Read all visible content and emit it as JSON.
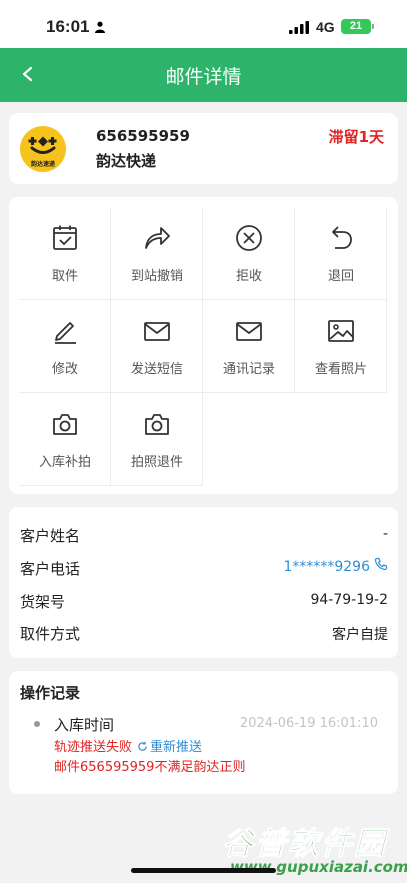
{
  "status_bar": {
    "time": "16:01",
    "network": "4G",
    "battery": "21"
  },
  "nav": {
    "title": "邮件详情"
  },
  "parcel": {
    "logo_text": "韵达速递",
    "tracking_number": "656595959",
    "courier": "韵达快递",
    "stay_status": "滞留1天"
  },
  "actions": [
    {
      "label": "取件",
      "icon": "calendar-check-icon"
    },
    {
      "label": "到站撤销",
      "icon": "share-arrow-icon"
    },
    {
      "label": "拒收",
      "icon": "circle-x-icon"
    },
    {
      "label": "退回",
      "icon": "undo-arrow-icon"
    },
    {
      "label": "修改",
      "icon": "pencil-icon"
    },
    {
      "label": "发送短信",
      "icon": "envelope-icon"
    },
    {
      "label": "通讯记录",
      "icon": "envelope-icon"
    },
    {
      "label": "查看照片",
      "icon": "photo-icon"
    },
    {
      "label": "入库补拍",
      "icon": "camera-icon"
    },
    {
      "label": "拍照退件",
      "icon": "camera-icon"
    }
  ],
  "customer": {
    "name_label": "客户姓名",
    "name_value": "-",
    "phone_label": "客户电话",
    "phone_value": "1******9296",
    "shelf_label": "货架号",
    "shelf_value": "94-79-19-2",
    "method_label": "取件方式",
    "method_value": "客户自提"
  },
  "log": {
    "title": "操作记录",
    "event": "入库时间",
    "time": "2024-06-19 16:01:10",
    "error": "轨迹推送失败",
    "resend_label": "重新推送",
    "detail": "邮件656595959不满足韵达正则"
  },
  "watermark": {
    "main": "谷普软件园",
    "url": "www.gupuxiazai.com"
  },
  "colors": {
    "brand_green": "#2db36a",
    "alert_red": "#e02424",
    "link_blue": "#2f8fd6"
  }
}
